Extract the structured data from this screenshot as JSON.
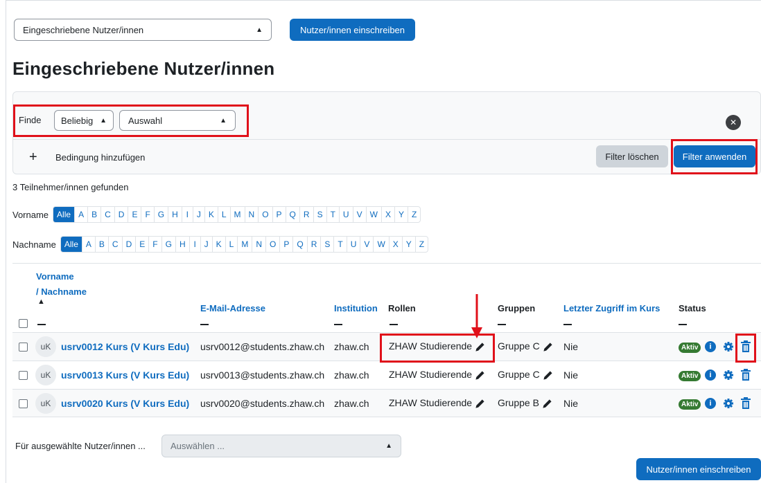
{
  "top_select": {
    "value": "Eingeschriebene Nutzer/innen"
  },
  "enrol_button": "Nutzer/innen einschreiben",
  "page_title": "Eingeschriebene Nutzer/innen",
  "filter": {
    "find_label": "Finde",
    "match_value": "Beliebig",
    "type_value": "Auswahl",
    "add_condition": "Bedingung hinzufügen",
    "clear_button": "Filter löschen",
    "apply_button": "Filter anwenden"
  },
  "participants_found": "3 Teilnehmer/innen gefunden",
  "firstname_filter": {
    "label": "Vorname",
    "all": "Alle",
    "letters": [
      "A",
      "B",
      "C",
      "D",
      "E",
      "F",
      "G",
      "H",
      "I",
      "J",
      "K",
      "L",
      "M",
      "N",
      "O",
      "P",
      "Q",
      "R",
      "S",
      "T",
      "U",
      "V",
      "W",
      "X",
      "Y",
      "Z"
    ]
  },
  "lastname_filter": {
    "label": "Nachname",
    "all": "Alle",
    "letters": [
      "A",
      "B",
      "C",
      "D",
      "E",
      "F",
      "G",
      "H",
      "I",
      "J",
      "K",
      "L",
      "M",
      "N",
      "O",
      "P",
      "Q",
      "R",
      "S",
      "T",
      "U",
      "V",
      "W",
      "X",
      "Y",
      "Z"
    ]
  },
  "table": {
    "headers": {
      "firstname": "Vorname",
      "lastname": "/ Nachname",
      "email": "E-Mail-Adresse",
      "institution": "Institution",
      "roles": "Rollen",
      "groups": "Gruppen",
      "last_access": "Letzter Zugriff im Kurs",
      "status": "Status"
    },
    "rows": [
      {
        "initials": "uK",
        "name": "usrv0012 Kurs (V Kurs Edu)",
        "email": "usrv0012@students.zhaw.ch",
        "institution": "zhaw.ch",
        "role": "ZHAW Studierende",
        "group": "Gruppe C",
        "last_access": "Nie",
        "status": "Aktiv"
      },
      {
        "initials": "uK",
        "name": "usrv0013 Kurs (V Kurs Edu)",
        "email": "usrv0013@students.zhaw.ch",
        "institution": "zhaw.ch",
        "role": "ZHAW Studierende",
        "group": "Gruppe C",
        "last_access": "Nie",
        "status": "Aktiv"
      },
      {
        "initials": "uK",
        "name": "usrv0020 Kurs (V Kurs Edu)",
        "email": "usrv0020@students.zhaw.ch",
        "institution": "zhaw.ch",
        "role": "ZHAW Studierende",
        "group": "Gruppe B",
        "last_access": "Nie",
        "status": "Aktiv"
      }
    ]
  },
  "bulk": {
    "label": "Für ausgewählte Nutzer/innen ...",
    "placeholder": "Auswählen ..."
  },
  "colors": {
    "primary": "#0f6cbf",
    "highlight": "#e0101a",
    "active_badge": "#357a32"
  }
}
